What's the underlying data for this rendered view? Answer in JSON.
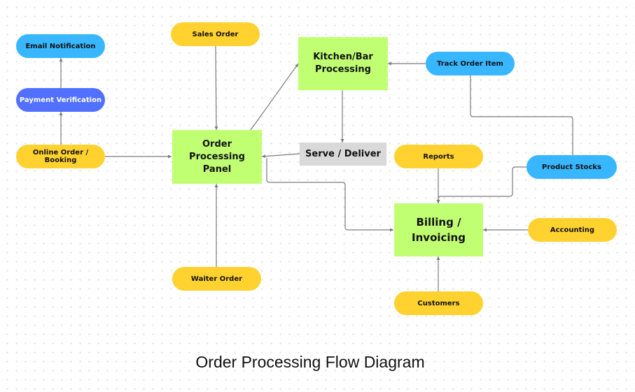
{
  "diagram": {
    "title": "Order Processing Flow Diagram",
    "colors": {
      "process_box": "#c1ff72",
      "input_pill": "#ffd230",
      "info_pill": "#38b6ff",
      "payment_pill": "#5170ff",
      "serve_box": "#d9d9d9",
      "connector": "#7a7a7a"
    },
    "nodes": {
      "email_notification": "Email Notification",
      "payment_verification": "Payment Verification",
      "online_order": "Online Order / Booking",
      "sales_order": "Sales Order",
      "order_panel": "Order Processing Panel",
      "waiter_order": "Waiter Order",
      "kitchen": "Kitchen/Bar Processing",
      "serve": "Serve / Deliver",
      "track_order": "Track Order Item",
      "reports": "Reports",
      "product_stocks": "Product Stocks",
      "billing": "Billing / Invoicing",
      "accounting": "Accounting",
      "customers": "Customers"
    },
    "edges": [
      {
        "from": "Payment Verification",
        "to": "Email Notification"
      },
      {
        "from": "Online Order / Booking",
        "to": "Payment Verification"
      },
      {
        "from": "Online Order / Booking",
        "to": "Order Processing Panel"
      },
      {
        "from": "Sales Order",
        "to": "Order Processing Panel"
      },
      {
        "from": "Waiter Order",
        "to": "Order Processing Panel"
      },
      {
        "from": "Order Processing Panel",
        "to": "Kitchen/Bar Processing"
      },
      {
        "from": "Kitchen/Bar Processing",
        "to": "Serve / Deliver"
      },
      {
        "from": "Serve / Deliver",
        "to": "Order Processing Panel"
      },
      {
        "from": "Track Order Item",
        "to": "Kitchen/Bar Processing"
      },
      {
        "from": "Track Order Item",
        "to": "Product Stocks"
      },
      {
        "from": "Order Processing Panel",
        "to": "Billing / Invoicing"
      },
      {
        "from": "Reports",
        "to": "Billing / Invoicing"
      },
      {
        "from": "Product Stocks",
        "to": "Billing / Invoicing"
      },
      {
        "from": "Accounting",
        "to": "Billing / Invoicing"
      },
      {
        "from": "Customers",
        "to": "Billing / Invoicing"
      }
    ]
  }
}
